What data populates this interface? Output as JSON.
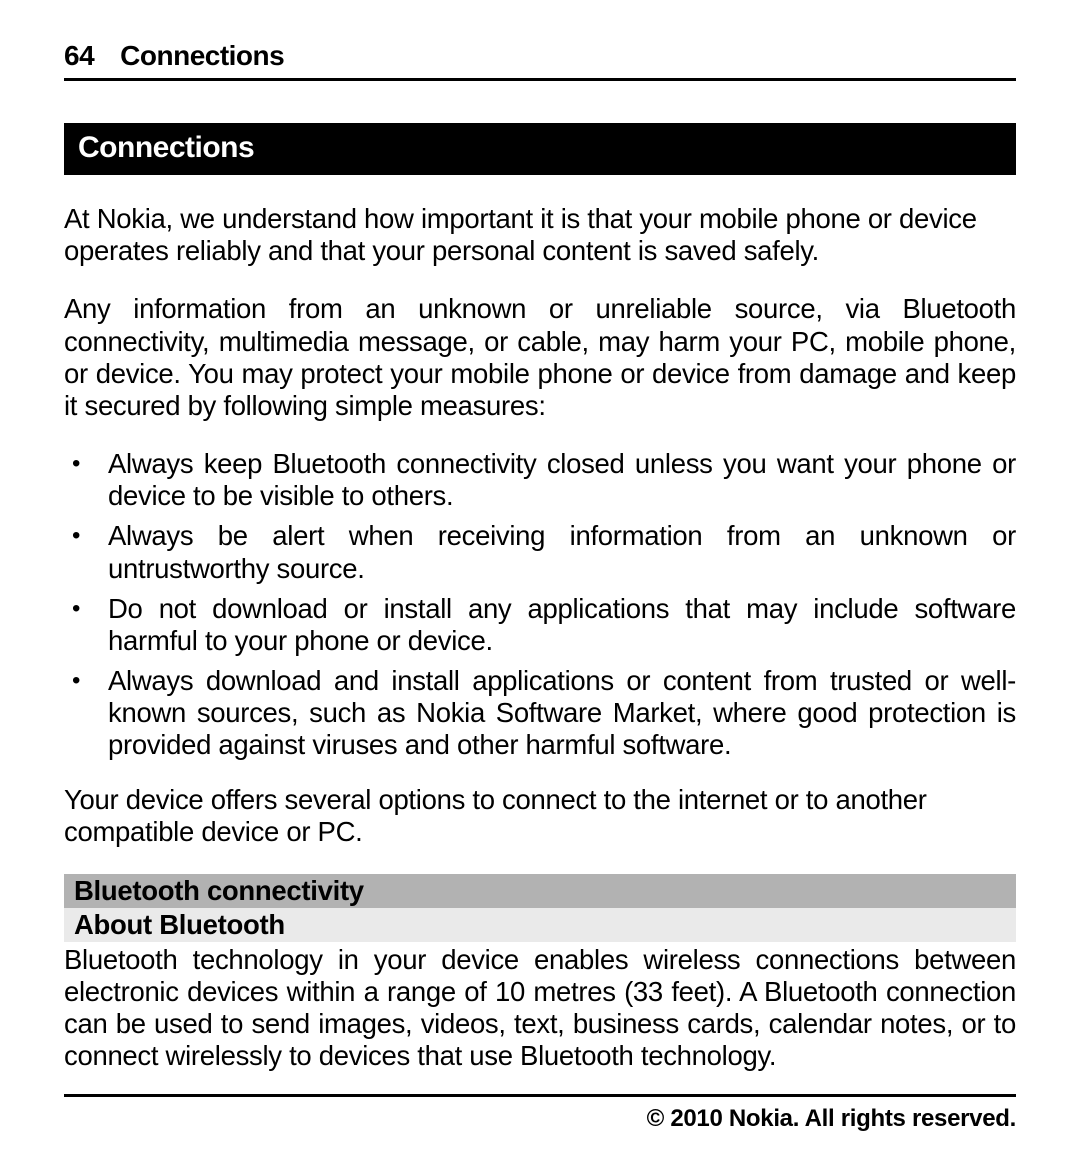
{
  "header": {
    "page_number": "64",
    "title": "Connections"
  },
  "section": {
    "heading": "Connections",
    "intro1": "At Nokia, we understand how important it is that your mobile phone or device operates reliably and that your personal content is saved safely.",
    "intro2": "Any information from an unknown or unreliable source, via Bluetooth connectivity, multimedia message, or cable, may harm your PC, mobile phone, or device. You may protect your mobile phone or device from damage and keep it secured by following simple measures:",
    "bullets": [
      "Always keep Bluetooth connectivity closed unless you want your phone or device to be visible to others.",
      "Always be alert when receiving information from an unknown or untrustworthy source.",
      "Do not download or install any applications that may include software harmful to your phone or device.",
      "Always download and install applications or content from trusted or well-known sources, such as Nokia Software Market, where good protection is provided against viruses and other harmful software."
    ],
    "outro": "Your device offers several options to connect to the internet or to another compatible device or PC."
  },
  "subsection": {
    "title1": "Bluetooth connectivity",
    "title2": "About Bluetooth",
    "body": "Bluetooth technology in your device enables wireless connections between electronic devices within a range of 10 metres (33 feet). A Bluetooth connection can be used to send images, videos, text, business cards, calendar notes, or to connect wirelessly to devices that use Bluetooth technology."
  },
  "footer": {
    "copyright": "© 2010 Nokia. All rights reserved."
  }
}
